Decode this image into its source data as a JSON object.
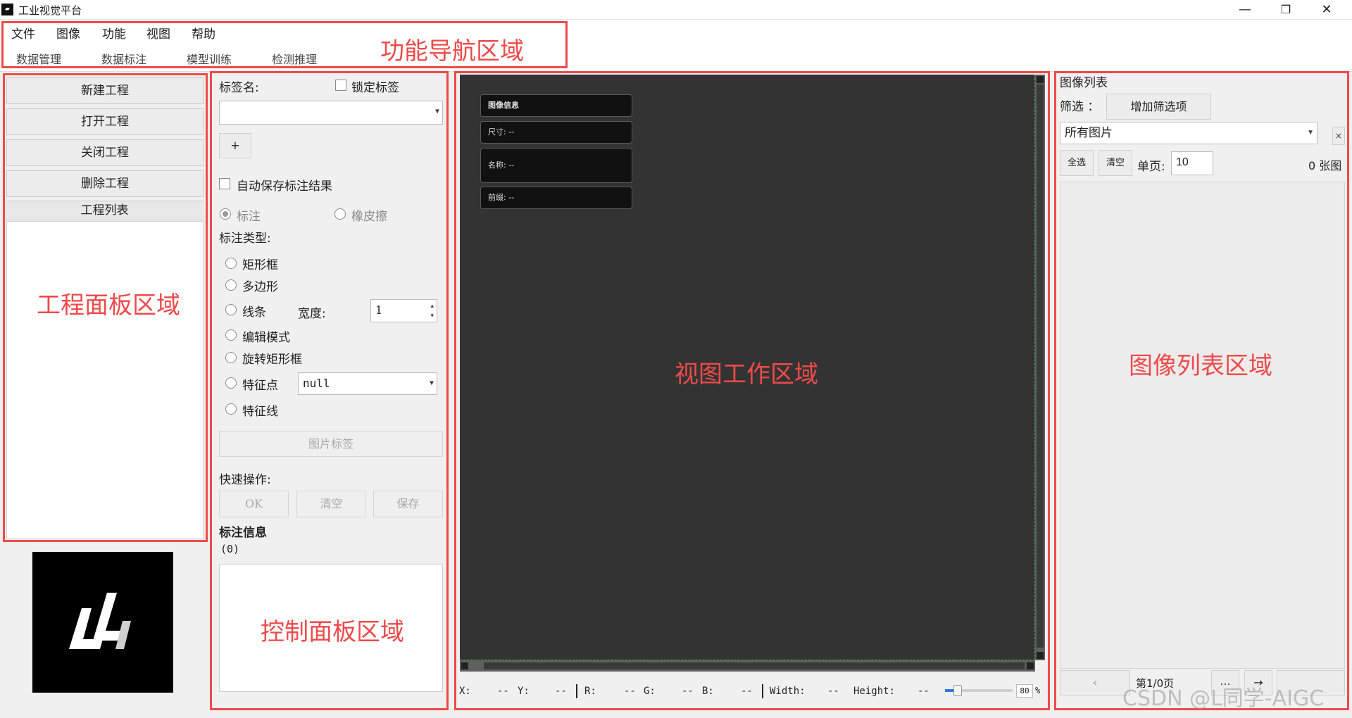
{
  "window": {
    "title": "工业视觉平台",
    "icon": "app-logo-icon",
    "controls": {
      "minimize": "—",
      "restore": "❐",
      "close": "✕"
    }
  },
  "menu": [
    "文件",
    "图像",
    "功能",
    "视图",
    "帮助"
  ],
  "tabs": [
    "数据管理",
    "数据标注",
    "模型训练",
    "检测推理"
  ],
  "annotations": {
    "nav": "功能导航区域",
    "project": "工程面板区域",
    "control": "控制面板区域",
    "view": "视图工作区域",
    "imagelist": "图像列表区域"
  },
  "project_panel": {
    "buttons": [
      "新建工程",
      "打开工程",
      "关闭工程",
      "删除工程"
    ],
    "list_header": "工程列表"
  },
  "control_panel": {
    "label_name": "标签名:",
    "lock_label": "锁定标签",
    "label_value": "",
    "add_button": "+",
    "auto_save": "自动保存标注结果",
    "mode_annotate": "标注",
    "mode_eraser": "橡皮擦",
    "annotation_type": "标注类型:",
    "types": [
      "矩形框",
      "多边形",
      "线条",
      "编辑模式",
      "旋转矩形框",
      "特征点",
      "特征线"
    ],
    "width_label": "宽度:",
    "width_value": "1",
    "feature_point_value": "null",
    "image_label_button": "图片标签",
    "quick_ops": "快速操作:",
    "ok_button": "OK",
    "clear_button": "清空",
    "save_button": "保存",
    "annotation_info": "标注信息",
    "annotation_count": "(0)"
  },
  "viewer": {
    "info_title": "图像信息",
    "size": "尺寸: --",
    "name": "名称: --",
    "prefix": "前缀: --"
  },
  "status": {
    "x_label": "X:",
    "x": "--",
    "y_label": "Y:",
    "y": "--",
    "r_label": "R:",
    "r": "--",
    "g_label": "G:",
    "g": "--",
    "b_label": "B:",
    "b": "--",
    "width_label": "Width:",
    "width": "--",
    "height_label": "Height:",
    "height": "--",
    "zoom": "80",
    "zoom_unit": "%"
  },
  "image_list": {
    "title": "图像列表",
    "filter_label": "筛选 ：",
    "add_filter_button": "增加筛选项",
    "filter_value": "所有图片",
    "filter_clear": "×",
    "select_all": "全选",
    "clear": "清空",
    "page_size_label": "单页:",
    "page_size": "10",
    "count": "0 张图",
    "prev": "‹",
    "page_info": "第1/0页",
    "more": "...",
    "go": "→"
  },
  "watermark": "CSDN @L同学-AIGC",
  "colors": {
    "annotation_red": "#ef4a4a",
    "viewer_bg": "#333333",
    "info_card_bg": "#111111"
  }
}
